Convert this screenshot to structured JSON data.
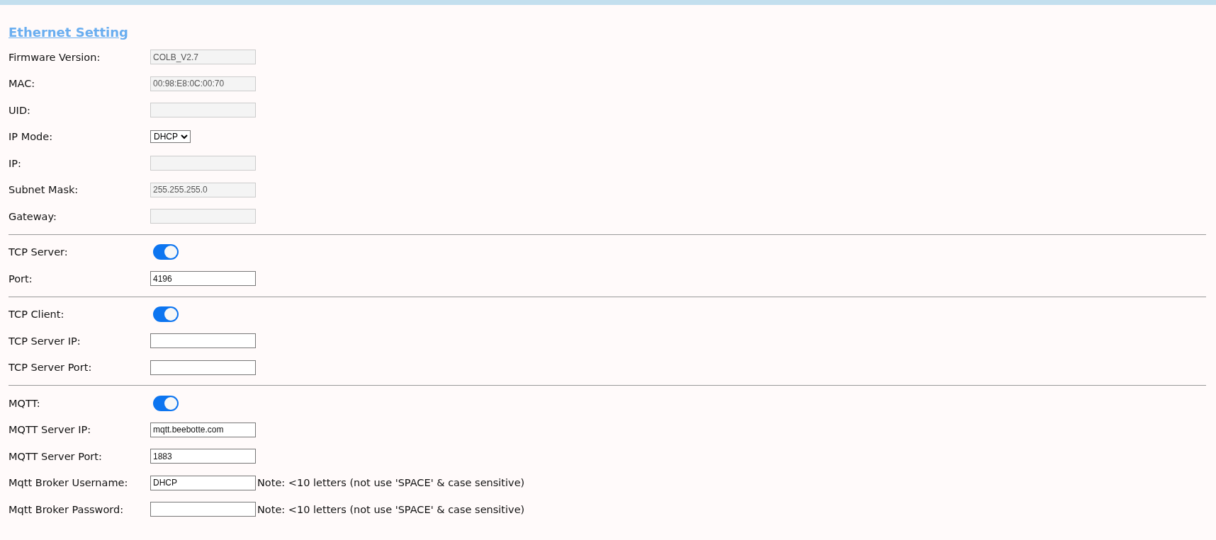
{
  "title": "Ethernet Setting",
  "sections": [
    {
      "rows": [
        {
          "kind": "field",
          "label": "Firmware Version:",
          "value": "COLB_V2.7",
          "readonly": true
        },
        {
          "kind": "field",
          "label": "MAC:",
          "value": "00:98:E8:0C:00:70",
          "readonly": true
        },
        {
          "kind": "field",
          "label": "UID:",
          "readonly": true
        },
        {
          "kind": "select",
          "label": "IP Mode:",
          "value": "DHCP"
        },
        {
          "kind": "field",
          "label": "IP:",
          "readonly": true
        },
        {
          "kind": "field",
          "label": "Subnet Mask:",
          "value": "255.255.255.0",
          "readonly": true
        },
        {
          "kind": "field",
          "label": "Gateway:",
          "readonly": true
        }
      ]
    },
    {
      "rows": [
        {
          "kind": "toggle",
          "label": "TCP Server:",
          "on": true
        },
        {
          "kind": "field",
          "label": "Port:",
          "value": "4196",
          "readonly": false
        }
      ]
    },
    {
      "rows": [
        {
          "kind": "toggle",
          "label": "TCP Client:",
          "on": true
        },
        {
          "kind": "field",
          "label": "TCP Server IP:",
          "readonly": false
        },
        {
          "kind": "field",
          "label": "TCP Server Port:",
          "readonly": false
        }
      ]
    },
    {
      "rows": [
        {
          "kind": "toggle",
          "label": "MQTT:",
          "on": true
        },
        {
          "kind": "field",
          "label": "MQTT Server IP:",
          "value": "mqtt.beebotte.com",
          "readonly": false
        },
        {
          "kind": "field",
          "label": "MQTT Server Port:",
          "value": "1883",
          "readonly": false
        },
        {
          "kind": "field",
          "label": "Mqtt Broker Username:",
          "value": "DHCP",
          "readonly": false,
          "note": "Note: <10 letters (not use 'SPACE' & case sensitive)"
        },
        {
          "kind": "field",
          "label": "Mqtt Broker Password:",
          "readonly": false,
          "note": "Note: <10 letters (not use 'SPACE' & case sensitive)"
        }
      ]
    }
  ]
}
